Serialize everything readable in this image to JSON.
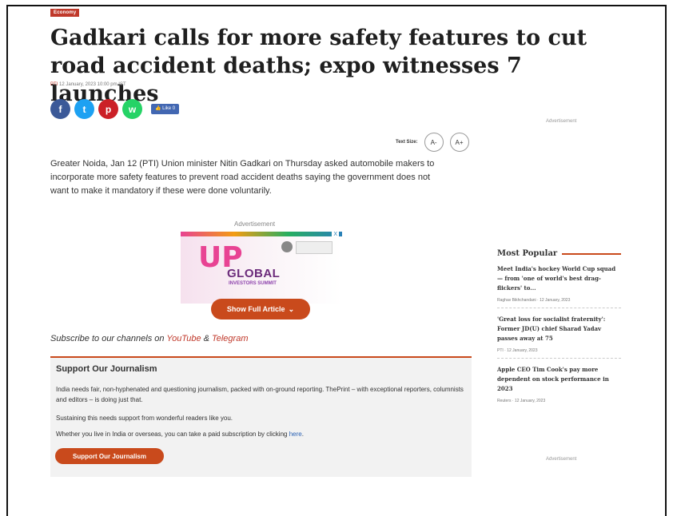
{
  "category": "Economy",
  "headline": "Gadkari calls for more safety features to cut road accident deaths; expo witnesses 7 launches",
  "byline": {
    "source": "PTI",
    "date": "12 January, 2023 10:00 pm IST"
  },
  "share": {
    "facebook_glyph": "f",
    "twitter_glyph": "t",
    "pinterest_glyph": "p",
    "whatsapp_glyph": "w",
    "like_label": "👍 Like 0"
  },
  "text_size": {
    "label": "Text Size:",
    "decrease": "A-",
    "increase": "A+"
  },
  "article": {
    "paragraph": "Greater Noida, Jan 12 (PTI) Union minister Nitin Gadkari on Thursday asked automobile makers to incorporate more safety features to prevent road accident deaths saying the government does not want to make it mandatory if these were done voluntarily."
  },
  "ad": {
    "label": "Advertisement",
    "banner_up": "UP",
    "banner_global": "GLOBAL",
    "banner_sub": "INVESTORS SUMMIT",
    "info": "X"
  },
  "show_full_article": {
    "label": "Show Full Article",
    "chevron": "⌄"
  },
  "subscribe": {
    "prefix": "Subscribe to our channels on ",
    "youtube": "YouTube",
    "amp": " & ",
    "telegram": "Telegram"
  },
  "support": {
    "title": "Support Our Journalism",
    "p1": "India needs fair, non-hyphenated and questioning journalism, packed with on-ground reporting. ThePrint – with exceptional reporters, columnists and editors – is doing just that.",
    "p2": "Sustaining this needs support from wonderful readers like you.",
    "p3_prefix": "Whether you live in India or overseas, you can take a paid subscription by clicking ",
    "p3_link": "here",
    "p3_suffix": ".",
    "button": "Support Our Journalism"
  },
  "sidebar": {
    "ad_label": "Advertisement",
    "most_popular_title": "Most Popular",
    "items": [
      {
        "title": "Meet India's hockey World Cup squad — from 'one of world's best drag-flickers' to...",
        "meta": "Raghav Bikhchandani · 12 January, 2023"
      },
      {
        "title": "'Great loss for socialist fraternity': Former JD(U) chief Sharad Yadav passes away at 75",
        "meta": "PTI · 12 January, 2023"
      },
      {
        "title": "Apple CEO Tim Cook's pay more dependent on stock performance in 2023",
        "meta": "Reuters · 12 January, 2023"
      }
    ],
    "ad_label_2": "Advertisement"
  },
  "colors": {
    "accent": "#c94a1c",
    "tag": "#c0392b",
    "link": "#2c63b5"
  }
}
